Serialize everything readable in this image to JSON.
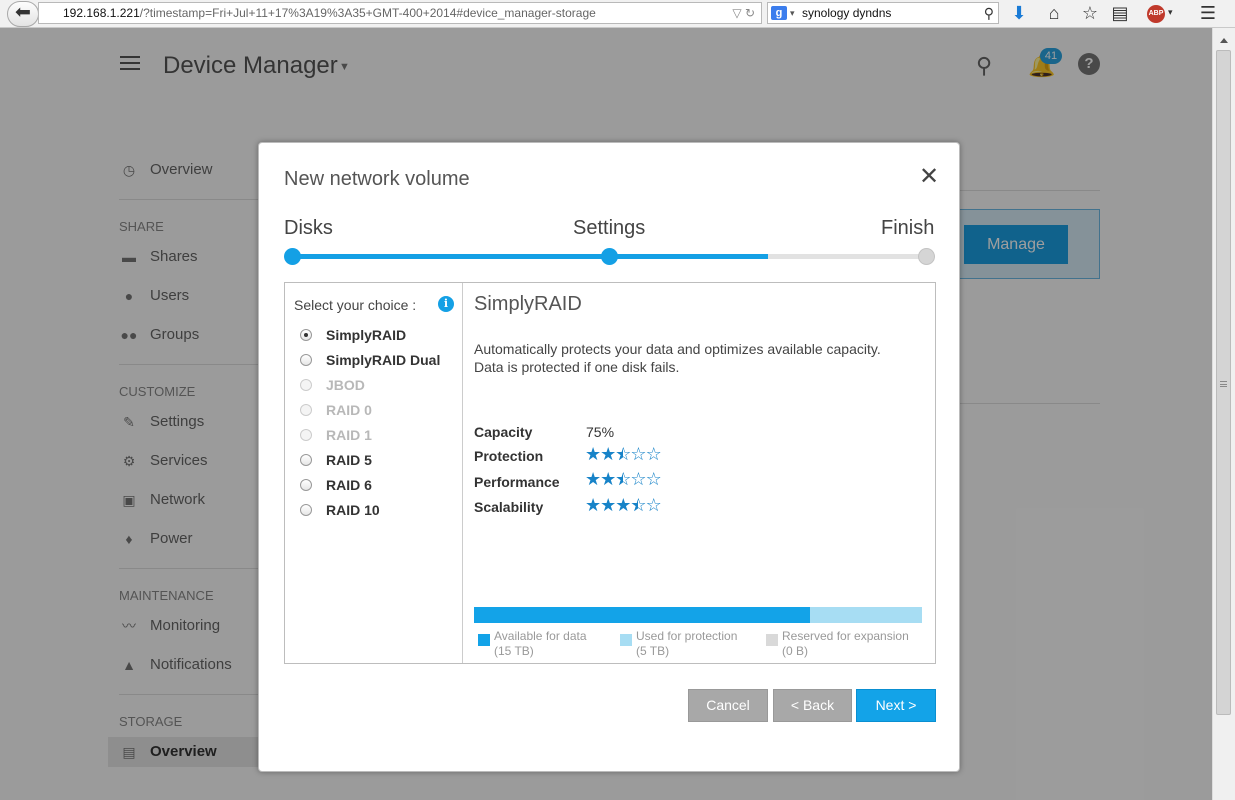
{
  "browser": {
    "url_host": "192.168.1.221",
    "url_path": "/?timestamp=Fri+Jul+11+17%3A19%3A35+GMT-400+2014#device_manager-storage",
    "search_value": "synology dyndns",
    "back_glyph": "⬅",
    "abp_label": "ABP"
  },
  "app": {
    "title": "Device Manager",
    "notifications_count": "41",
    "help_glyph": "?"
  },
  "sidebar": {
    "overview": "Overview",
    "share_section": "SHARE",
    "shares": "Shares",
    "users": "Users",
    "groups": "Groups",
    "customize_section": "CUSTOMIZE",
    "settings": "Settings",
    "services": "Services",
    "network": "Network",
    "power": "Power",
    "maintenance_section": "MAINTENANCE",
    "monitoring": "Monitoring",
    "notifications": "Notifications",
    "storage_section": "STORAGE",
    "storage_overview": "Overview"
  },
  "background": {
    "manage_label": "Manage"
  },
  "modal": {
    "title": "New network volume",
    "steps": [
      "Disks",
      "Settings",
      "Finish"
    ],
    "progress_fraction": 0.75,
    "choice_title": "Select your choice :",
    "info_glyph": "i",
    "options": [
      {
        "label": "SimplyRAID",
        "checked": true,
        "disabled": false
      },
      {
        "label": "SimplyRAID Dual",
        "checked": false,
        "disabled": false
      },
      {
        "label": "JBOD",
        "checked": false,
        "disabled": true
      },
      {
        "label": "RAID 0",
        "checked": false,
        "disabled": true
      },
      {
        "label": "RAID 1",
        "checked": false,
        "disabled": true
      },
      {
        "label": "RAID 5",
        "checked": false,
        "disabled": false
      },
      {
        "label": "RAID 6",
        "checked": false,
        "disabled": false
      },
      {
        "label": "RAID 10",
        "checked": false,
        "disabled": false
      }
    ],
    "detail": {
      "title": "SimplyRAID",
      "description_line1": "Automatically protects your data and optimizes available capacity.",
      "description_line2": "Data is protected if one disk fails.",
      "capacity_label": "Capacity",
      "capacity_value": "75%",
      "protection_label": "Protection",
      "protection_rating": 2.5,
      "performance_label": "Performance",
      "performance_rating": 2.5,
      "scalability_label": "Scalability",
      "scalability_rating": 3.5,
      "used_fraction": 0.75,
      "legend_available": "Available for data",
      "legend_available_size": "(15 TB)",
      "legend_protection": "Used for protection",
      "legend_protection_size": "(5 TB)",
      "legend_reserved": "Reserved for expansion",
      "legend_reserved_size": "(0 B)"
    },
    "buttons": {
      "cancel": "Cancel",
      "back": "< Back",
      "next": "Next >"
    },
    "colors": {
      "accent": "#14a0e5",
      "protection": "#a7ddf3",
      "reserved": "#d9d9d9",
      "star": "#1783c8"
    }
  }
}
